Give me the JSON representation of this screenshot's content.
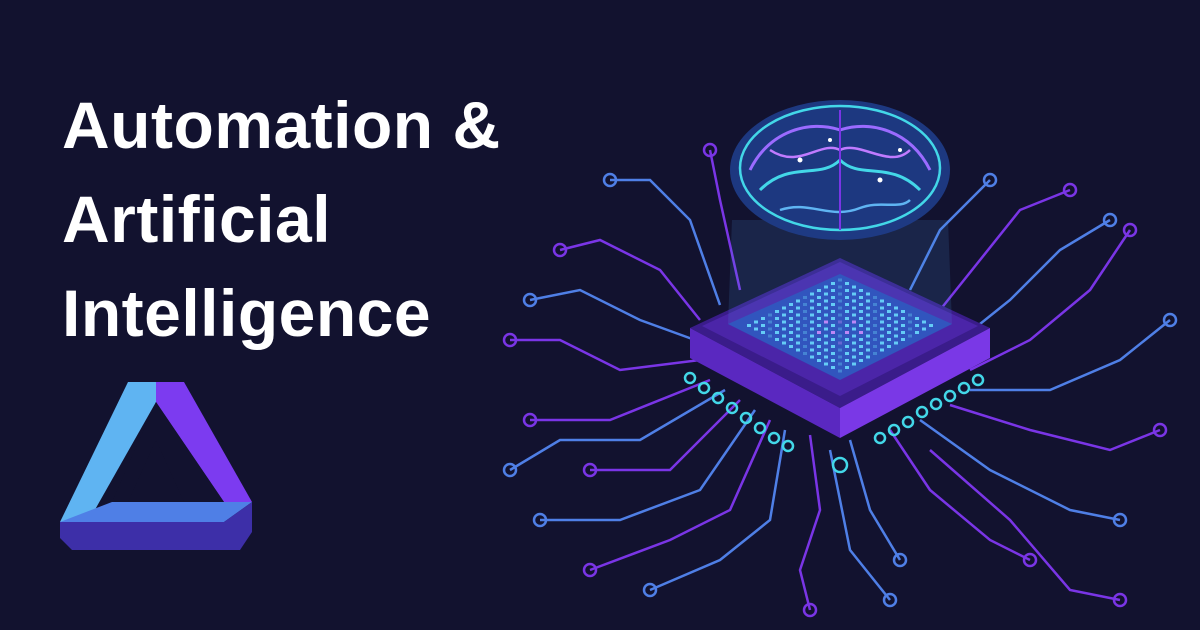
{
  "headline": {
    "line1": "Automation &",
    "line2": "Artificial",
    "line3": "Intelligence"
  },
  "logo": {
    "icon": "penrose-triangle-icon"
  },
  "illustration": {
    "icon": "ai-chip-brain-icon"
  },
  "colors": {
    "background": "#12122f",
    "text": "#ffffff",
    "logo_light": "#5fb4f2",
    "logo_mid": "#4f7fe6",
    "logo_violet": "#7c3bf0",
    "logo_deep": "#3d2fa8",
    "circuit_purple": "#7a35e6",
    "circuit_blue": "#4f7fe6",
    "circuit_cyan": "#43d7e8",
    "chip_body": "#6a2fd4",
    "chip_top": "#4b25a8"
  }
}
